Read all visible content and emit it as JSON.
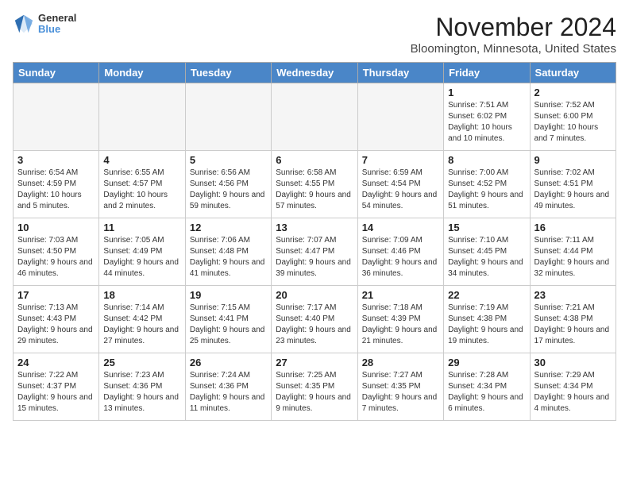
{
  "header": {
    "logo_general": "General",
    "logo_blue": "Blue",
    "month_title": "November 2024",
    "location": "Bloomington, Minnesota, United States"
  },
  "days_of_week": [
    "Sunday",
    "Monday",
    "Tuesday",
    "Wednesday",
    "Thursday",
    "Friday",
    "Saturday"
  ],
  "weeks": [
    {
      "days": [
        {
          "num": "",
          "info": ""
        },
        {
          "num": "",
          "info": ""
        },
        {
          "num": "",
          "info": ""
        },
        {
          "num": "",
          "info": ""
        },
        {
          "num": "",
          "info": ""
        },
        {
          "num": "1",
          "info": "Sunrise: 7:51 AM\nSunset: 6:02 PM\nDaylight: 10 hours and 10 minutes."
        },
        {
          "num": "2",
          "info": "Sunrise: 7:52 AM\nSunset: 6:00 PM\nDaylight: 10 hours and 7 minutes."
        }
      ]
    },
    {
      "days": [
        {
          "num": "3",
          "info": "Sunrise: 6:54 AM\nSunset: 4:59 PM\nDaylight: 10 hours and 5 minutes."
        },
        {
          "num": "4",
          "info": "Sunrise: 6:55 AM\nSunset: 4:57 PM\nDaylight: 10 hours and 2 minutes."
        },
        {
          "num": "5",
          "info": "Sunrise: 6:56 AM\nSunset: 4:56 PM\nDaylight: 9 hours and 59 minutes."
        },
        {
          "num": "6",
          "info": "Sunrise: 6:58 AM\nSunset: 4:55 PM\nDaylight: 9 hours and 57 minutes."
        },
        {
          "num": "7",
          "info": "Sunrise: 6:59 AM\nSunset: 4:54 PM\nDaylight: 9 hours and 54 minutes."
        },
        {
          "num": "8",
          "info": "Sunrise: 7:00 AM\nSunset: 4:52 PM\nDaylight: 9 hours and 51 minutes."
        },
        {
          "num": "9",
          "info": "Sunrise: 7:02 AM\nSunset: 4:51 PM\nDaylight: 9 hours and 49 minutes."
        }
      ]
    },
    {
      "days": [
        {
          "num": "10",
          "info": "Sunrise: 7:03 AM\nSunset: 4:50 PM\nDaylight: 9 hours and 46 minutes."
        },
        {
          "num": "11",
          "info": "Sunrise: 7:05 AM\nSunset: 4:49 PM\nDaylight: 9 hours and 44 minutes."
        },
        {
          "num": "12",
          "info": "Sunrise: 7:06 AM\nSunset: 4:48 PM\nDaylight: 9 hours and 41 minutes."
        },
        {
          "num": "13",
          "info": "Sunrise: 7:07 AM\nSunset: 4:47 PM\nDaylight: 9 hours and 39 minutes."
        },
        {
          "num": "14",
          "info": "Sunrise: 7:09 AM\nSunset: 4:46 PM\nDaylight: 9 hours and 36 minutes."
        },
        {
          "num": "15",
          "info": "Sunrise: 7:10 AM\nSunset: 4:45 PM\nDaylight: 9 hours and 34 minutes."
        },
        {
          "num": "16",
          "info": "Sunrise: 7:11 AM\nSunset: 4:44 PM\nDaylight: 9 hours and 32 minutes."
        }
      ]
    },
    {
      "days": [
        {
          "num": "17",
          "info": "Sunrise: 7:13 AM\nSunset: 4:43 PM\nDaylight: 9 hours and 29 minutes."
        },
        {
          "num": "18",
          "info": "Sunrise: 7:14 AM\nSunset: 4:42 PM\nDaylight: 9 hours and 27 minutes."
        },
        {
          "num": "19",
          "info": "Sunrise: 7:15 AM\nSunset: 4:41 PM\nDaylight: 9 hours and 25 minutes."
        },
        {
          "num": "20",
          "info": "Sunrise: 7:17 AM\nSunset: 4:40 PM\nDaylight: 9 hours and 23 minutes."
        },
        {
          "num": "21",
          "info": "Sunrise: 7:18 AM\nSunset: 4:39 PM\nDaylight: 9 hours and 21 minutes."
        },
        {
          "num": "22",
          "info": "Sunrise: 7:19 AM\nSunset: 4:38 PM\nDaylight: 9 hours and 19 minutes."
        },
        {
          "num": "23",
          "info": "Sunrise: 7:21 AM\nSunset: 4:38 PM\nDaylight: 9 hours and 17 minutes."
        }
      ]
    },
    {
      "days": [
        {
          "num": "24",
          "info": "Sunrise: 7:22 AM\nSunset: 4:37 PM\nDaylight: 9 hours and 15 minutes."
        },
        {
          "num": "25",
          "info": "Sunrise: 7:23 AM\nSunset: 4:36 PM\nDaylight: 9 hours and 13 minutes."
        },
        {
          "num": "26",
          "info": "Sunrise: 7:24 AM\nSunset: 4:36 PM\nDaylight: 9 hours and 11 minutes."
        },
        {
          "num": "27",
          "info": "Sunrise: 7:25 AM\nSunset: 4:35 PM\nDaylight: 9 hours and 9 minutes."
        },
        {
          "num": "28",
          "info": "Sunrise: 7:27 AM\nSunset: 4:35 PM\nDaylight: 9 hours and 7 minutes."
        },
        {
          "num": "29",
          "info": "Sunrise: 7:28 AM\nSunset: 4:34 PM\nDaylight: 9 hours and 6 minutes."
        },
        {
          "num": "30",
          "info": "Sunrise: 7:29 AM\nSunset: 4:34 PM\nDaylight: 9 hours and 4 minutes."
        }
      ]
    }
  ]
}
